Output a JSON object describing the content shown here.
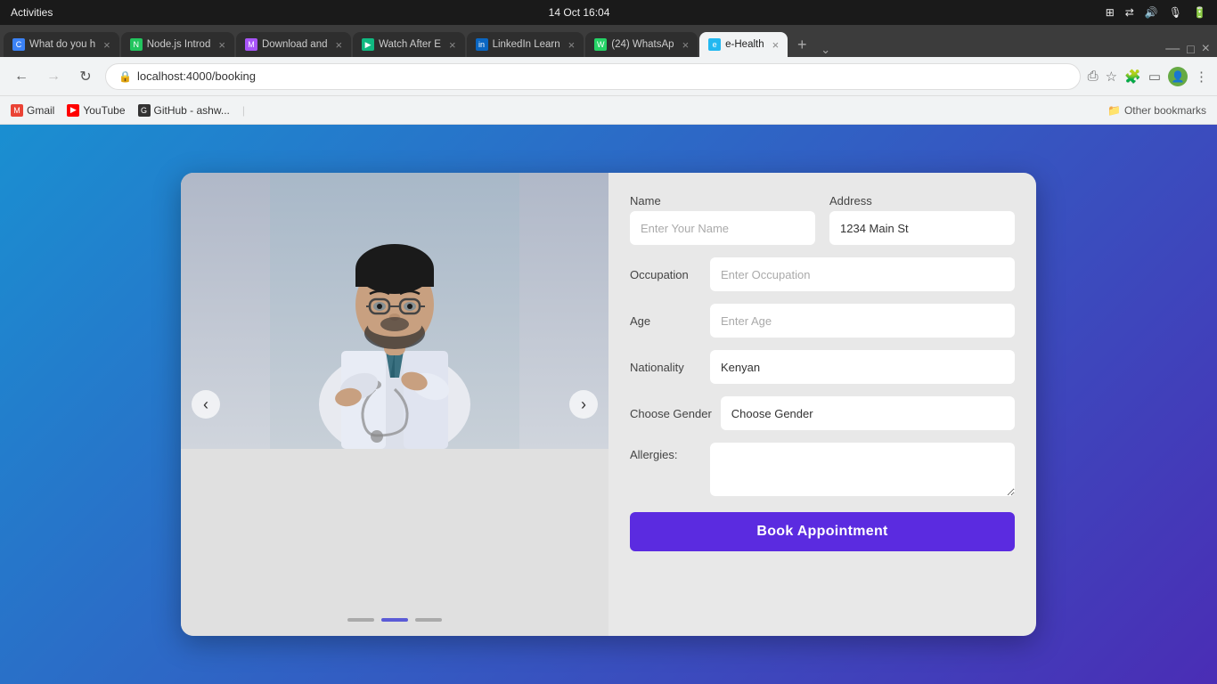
{
  "statusbar": {
    "left": "Activities",
    "center": "14 Oct  16:04",
    "right_items": [
      "⊞",
      "⇄",
      "🔊",
      "🎙",
      "🔋"
    ]
  },
  "browser": {
    "tabs": [
      {
        "id": "tab-c",
        "label": "What do you h",
        "favicon_type": "c",
        "favicon_letter": "C",
        "active": false
      },
      {
        "id": "tab-n",
        "label": "Node.js Introd",
        "favicon_type": "n",
        "favicon_letter": "N",
        "active": false
      },
      {
        "id": "tab-d",
        "label": "Download and",
        "favicon_type": "m",
        "favicon_letter": "M",
        "active": false
      },
      {
        "id": "tab-w",
        "label": "Watch After E",
        "favicon_type": "w",
        "favicon_letter": "▶",
        "active": false
      },
      {
        "id": "tab-li",
        "label": "LinkedIn Learn",
        "favicon_type": "li",
        "favicon_letter": "in",
        "active": false
      },
      {
        "id": "tab-wa",
        "label": "(24) WhatsAp",
        "favicon_type": "wa",
        "favicon_letter": "W",
        "active": false
      },
      {
        "id": "tab-eh",
        "label": "e-Health",
        "favicon_type": "eh",
        "favicon_letter": "e",
        "active": true
      }
    ],
    "address": "localhost:4000/booking",
    "bookmarks": [
      {
        "label": "Gmail",
        "favicon_color": "#ea4335",
        "favicon_letter": "M"
      },
      {
        "label": "YouTube",
        "favicon_color": "#ff0000",
        "favicon_letter": "▶"
      },
      {
        "label": "GitHub - ashw...",
        "favicon_color": "#333",
        "favicon_letter": "G"
      }
    ],
    "other_bookmarks_label": "Other bookmarks"
  },
  "form": {
    "title": "Book Appointment",
    "fields": {
      "name_label": "Name",
      "name_placeholder": "Enter Your Name",
      "address_label": "Address",
      "address_value": "1234 Main St",
      "occupation_label": "Occupation",
      "occupation_placeholder": "Enter Occupation",
      "age_label": "Age",
      "age_placeholder": "Enter Age",
      "nationality_label": "Nationality",
      "nationality_value": "Kenyan",
      "gender_label": "Choose Gender",
      "gender_value": "Choose Gender",
      "allergies_label": "Allergies:"
    },
    "submit_label": "Book Appointment"
  },
  "carousel": {
    "dots": [
      {
        "active": false
      },
      {
        "active": true
      },
      {
        "active": false
      }
    ],
    "prev_label": "‹",
    "next_label": "›"
  }
}
